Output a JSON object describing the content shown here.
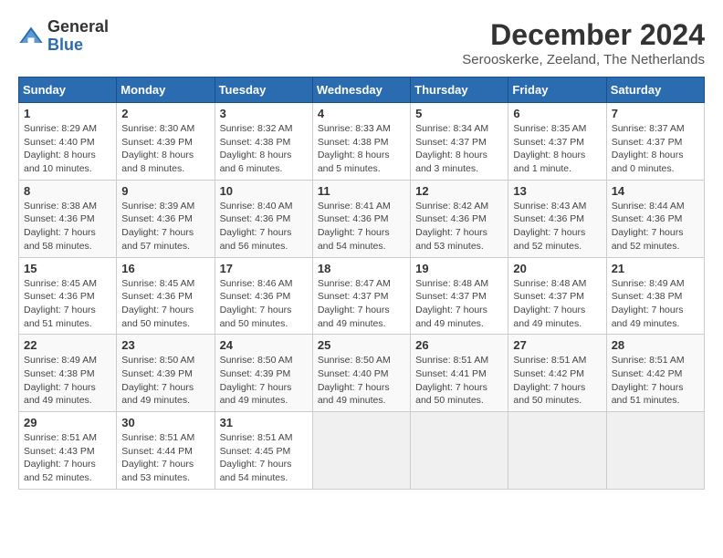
{
  "header": {
    "logo_general": "General",
    "logo_blue": "Blue",
    "title": "December 2024",
    "location": "Serooskerke, Zeeland, The Netherlands"
  },
  "calendar": {
    "days_of_week": [
      "Sunday",
      "Monday",
      "Tuesday",
      "Wednesday",
      "Thursday",
      "Friday",
      "Saturday"
    ],
    "weeks": [
      [
        {
          "day": "1",
          "info": "Sunrise: 8:29 AM\nSunset: 4:40 PM\nDaylight: 8 hours\nand 10 minutes."
        },
        {
          "day": "2",
          "info": "Sunrise: 8:30 AM\nSunset: 4:39 PM\nDaylight: 8 hours\nand 8 minutes."
        },
        {
          "day": "3",
          "info": "Sunrise: 8:32 AM\nSunset: 4:38 PM\nDaylight: 8 hours\nand 6 minutes."
        },
        {
          "day": "4",
          "info": "Sunrise: 8:33 AM\nSunset: 4:38 PM\nDaylight: 8 hours\nand 5 minutes."
        },
        {
          "day": "5",
          "info": "Sunrise: 8:34 AM\nSunset: 4:37 PM\nDaylight: 8 hours\nand 3 minutes."
        },
        {
          "day": "6",
          "info": "Sunrise: 8:35 AM\nSunset: 4:37 PM\nDaylight: 8 hours\nand 1 minute."
        },
        {
          "day": "7",
          "info": "Sunrise: 8:37 AM\nSunset: 4:37 PM\nDaylight: 8 hours\nand 0 minutes."
        }
      ],
      [
        {
          "day": "8",
          "info": "Sunrise: 8:38 AM\nSunset: 4:36 PM\nDaylight: 7 hours\nand 58 minutes."
        },
        {
          "day": "9",
          "info": "Sunrise: 8:39 AM\nSunset: 4:36 PM\nDaylight: 7 hours\nand 57 minutes."
        },
        {
          "day": "10",
          "info": "Sunrise: 8:40 AM\nSunset: 4:36 PM\nDaylight: 7 hours\nand 56 minutes."
        },
        {
          "day": "11",
          "info": "Sunrise: 8:41 AM\nSunset: 4:36 PM\nDaylight: 7 hours\nand 54 minutes."
        },
        {
          "day": "12",
          "info": "Sunrise: 8:42 AM\nSunset: 4:36 PM\nDaylight: 7 hours\nand 53 minutes."
        },
        {
          "day": "13",
          "info": "Sunrise: 8:43 AM\nSunset: 4:36 PM\nDaylight: 7 hours\nand 52 minutes."
        },
        {
          "day": "14",
          "info": "Sunrise: 8:44 AM\nSunset: 4:36 PM\nDaylight: 7 hours\nand 52 minutes."
        }
      ],
      [
        {
          "day": "15",
          "info": "Sunrise: 8:45 AM\nSunset: 4:36 PM\nDaylight: 7 hours\nand 51 minutes."
        },
        {
          "day": "16",
          "info": "Sunrise: 8:45 AM\nSunset: 4:36 PM\nDaylight: 7 hours\nand 50 minutes."
        },
        {
          "day": "17",
          "info": "Sunrise: 8:46 AM\nSunset: 4:36 PM\nDaylight: 7 hours\nand 50 minutes."
        },
        {
          "day": "18",
          "info": "Sunrise: 8:47 AM\nSunset: 4:37 PM\nDaylight: 7 hours\nand 49 minutes."
        },
        {
          "day": "19",
          "info": "Sunrise: 8:48 AM\nSunset: 4:37 PM\nDaylight: 7 hours\nand 49 minutes."
        },
        {
          "day": "20",
          "info": "Sunrise: 8:48 AM\nSunset: 4:37 PM\nDaylight: 7 hours\nand 49 minutes."
        },
        {
          "day": "21",
          "info": "Sunrise: 8:49 AM\nSunset: 4:38 PM\nDaylight: 7 hours\nand 49 minutes."
        }
      ],
      [
        {
          "day": "22",
          "info": "Sunrise: 8:49 AM\nSunset: 4:38 PM\nDaylight: 7 hours\nand 49 minutes."
        },
        {
          "day": "23",
          "info": "Sunrise: 8:50 AM\nSunset: 4:39 PM\nDaylight: 7 hours\nand 49 minutes."
        },
        {
          "day": "24",
          "info": "Sunrise: 8:50 AM\nSunset: 4:39 PM\nDaylight: 7 hours\nand 49 minutes."
        },
        {
          "day": "25",
          "info": "Sunrise: 8:50 AM\nSunset: 4:40 PM\nDaylight: 7 hours\nand 49 minutes."
        },
        {
          "day": "26",
          "info": "Sunrise: 8:51 AM\nSunset: 4:41 PM\nDaylight: 7 hours\nand 50 minutes."
        },
        {
          "day": "27",
          "info": "Sunrise: 8:51 AM\nSunset: 4:42 PM\nDaylight: 7 hours\nand 50 minutes."
        },
        {
          "day": "28",
          "info": "Sunrise: 8:51 AM\nSunset: 4:42 PM\nDaylight: 7 hours\nand 51 minutes."
        }
      ],
      [
        {
          "day": "29",
          "info": "Sunrise: 8:51 AM\nSunset: 4:43 PM\nDaylight: 7 hours\nand 52 minutes."
        },
        {
          "day": "30",
          "info": "Sunrise: 8:51 AM\nSunset: 4:44 PM\nDaylight: 7 hours\nand 53 minutes."
        },
        {
          "day": "31",
          "info": "Sunrise: 8:51 AM\nSunset: 4:45 PM\nDaylight: 7 hours\nand 54 minutes."
        },
        {
          "day": "",
          "info": ""
        },
        {
          "day": "",
          "info": ""
        },
        {
          "day": "",
          "info": ""
        },
        {
          "day": "",
          "info": ""
        }
      ]
    ]
  }
}
